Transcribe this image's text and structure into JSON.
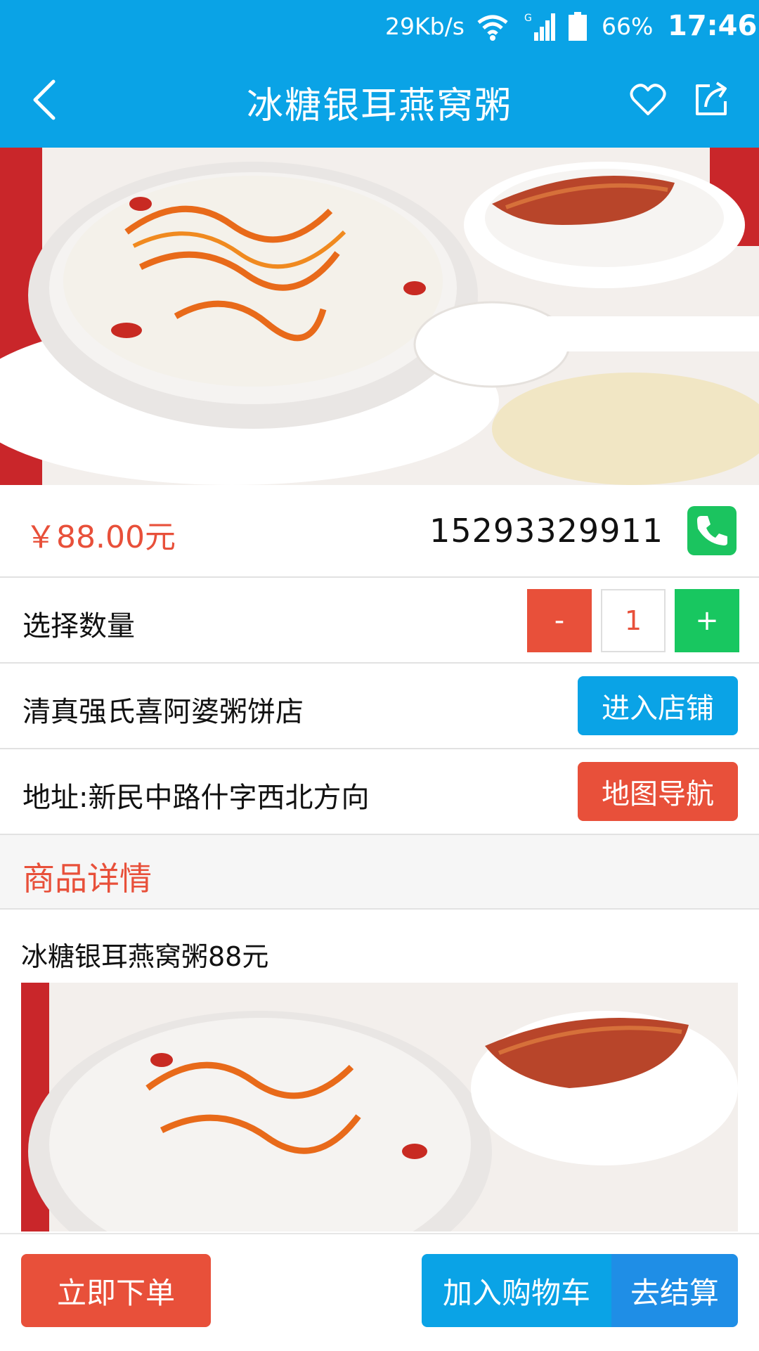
{
  "status_bar": {
    "network_speed": "29Kb/s",
    "signal_label": "G",
    "battery": "66%",
    "time": "17:46",
    "icons": [
      "wifi-icon",
      "signal-icon",
      "battery-icon"
    ]
  },
  "header": {
    "title": "冰糖银耳燕窝粥",
    "icons": [
      "back-arrow-icon",
      "heart-icon",
      "share-icon"
    ]
  },
  "product": {
    "price": "￥88.00元",
    "phone": "15293329911",
    "phone_icon": "phone-icon",
    "quantity_label": "选择数量",
    "qty_minus": "-",
    "qty_value": "1",
    "qty_plus": "+",
    "store_name": "清真强氏喜阿婆粥饼店",
    "store_button": "进入店铺",
    "address": "地址:新民中路什字西北方向",
    "map_button": "地图导航"
  },
  "details": {
    "section_title": "商品详情",
    "description": "冰糖银耳燕窝粥88元"
  },
  "bottom_bar": {
    "order_now": "立即下单",
    "add_to_cart": "加入购物车",
    "checkout": "去结算"
  },
  "colors": {
    "primary_blue": "#0aa3e6",
    "accent_red": "#e8503a",
    "green": "#18c760"
  }
}
